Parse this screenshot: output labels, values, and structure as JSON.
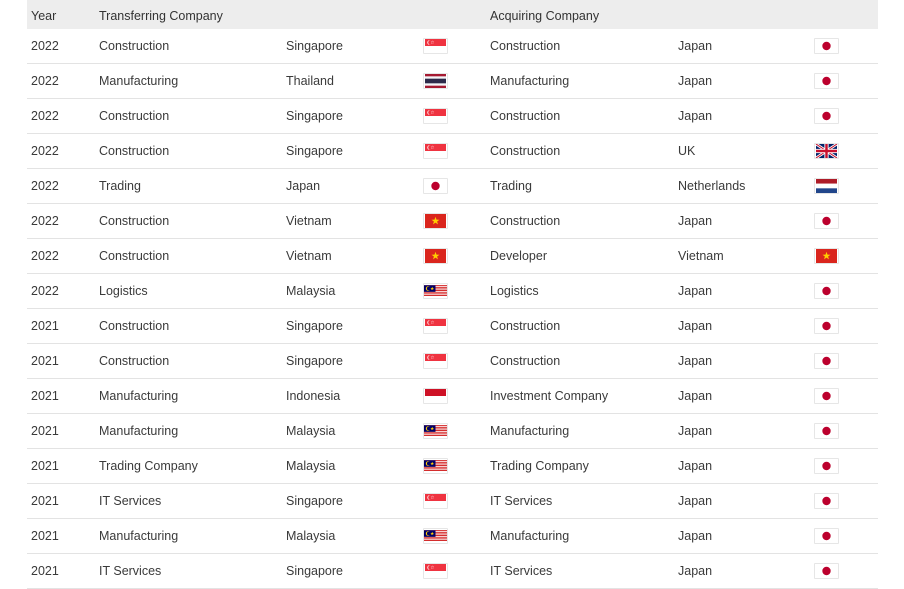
{
  "header": {
    "year": "Year",
    "transferring_company": "Transferring Company",
    "acquiring_company": "Acquiring Company"
  },
  "rows": [
    {
      "year": "2022",
      "t_industry": "Construction",
      "t_country": "Singapore",
      "t_flag": "singapore-flag-icon",
      "a_industry": "Construction",
      "a_country": "Japan",
      "a_flag": "japan-flag-icon"
    },
    {
      "year": "2022",
      "t_industry": "Manufacturing",
      "t_country": "Thailand",
      "t_flag": "thailand-flag-icon",
      "a_industry": "Manufacturing",
      "a_country": "Japan",
      "a_flag": "japan-flag-icon"
    },
    {
      "year": "2022",
      "t_industry": "Construction",
      "t_country": "Singapore",
      "t_flag": "singapore-flag-icon",
      "a_industry": "Construction",
      "a_country": "Japan",
      "a_flag": "japan-flag-icon"
    },
    {
      "year": "2022",
      "t_industry": "Construction",
      "t_country": "Singapore",
      "t_flag": "singapore-flag-icon",
      "a_industry": "Construction",
      "a_country": "UK",
      "a_flag": "uk-flag-icon"
    },
    {
      "year": "2022",
      "t_industry": "Trading",
      "t_country": "Japan",
      "t_flag": "japan-flag-icon",
      "a_industry": "Trading",
      "a_country": "Netherlands",
      "a_flag": "netherlands-flag-icon"
    },
    {
      "year": "2022",
      "t_industry": "Construction",
      "t_country": "Vietnam",
      "t_flag": "vietnam-flag-icon",
      "a_industry": "Construction",
      "a_country": "Japan",
      "a_flag": "japan-flag-icon"
    },
    {
      "year": "2022",
      "t_industry": "Construction",
      "t_country": "Vietnam",
      "t_flag": "vietnam-flag-icon",
      "a_industry": "Developer",
      "a_country": "Vietnam",
      "a_flag": "vietnam-flag-icon"
    },
    {
      "year": "2022",
      "t_industry": "Logistics",
      "t_country": "Malaysia",
      "t_flag": "malaysia-flag-icon",
      "a_industry": "Logistics",
      "a_country": "Japan",
      "a_flag": "japan-flag-icon"
    },
    {
      "year": "2021",
      "t_industry": "Construction",
      "t_country": "Singapore",
      "t_flag": "singapore-flag-icon",
      "a_industry": "Construction",
      "a_country": "Japan",
      "a_flag": "japan-flag-icon"
    },
    {
      "year": "2021",
      "t_industry": "Construction",
      "t_country": "Singapore",
      "t_flag": "singapore-flag-icon",
      "a_industry": "Construction",
      "a_country": "Japan",
      "a_flag": "japan-flag-icon"
    },
    {
      "year": "2021",
      "t_industry": "Manufacturing",
      "t_country": "Indonesia",
      "t_flag": "indonesia-flag-icon",
      "a_industry": "Investment Company",
      "a_country": "Japan",
      "a_flag": "japan-flag-icon"
    },
    {
      "year": "2021",
      "t_industry": "Manufacturing",
      "t_country": "Malaysia",
      "t_flag": "malaysia-flag-icon",
      "a_industry": "Manufacturing",
      "a_country": "Japan",
      "a_flag": "japan-flag-icon"
    },
    {
      "year": "2021",
      "t_industry": "Trading Company",
      "t_country": "Malaysia",
      "t_flag": "malaysia-flag-icon",
      "a_industry": "Trading Company",
      "a_country": "Japan",
      "a_flag": "japan-flag-icon"
    },
    {
      "year": "2021",
      "t_industry": "IT Services",
      "t_country": "Singapore",
      "t_flag": "singapore-flag-icon",
      "a_industry": "IT Services",
      "a_country": "Japan",
      "a_flag": "japan-flag-icon"
    },
    {
      "year": "2021",
      "t_industry": "Manufacturing",
      "t_country": "Malaysia",
      "t_flag": "malaysia-flag-icon",
      "a_industry": "Manufacturing",
      "a_country": "Japan",
      "a_flag": "japan-flag-icon"
    },
    {
      "year": "2021",
      "t_industry": "IT Services",
      "t_country": "Singapore",
      "t_flag": "singapore-flag-icon",
      "a_industry": "IT Services",
      "a_country": "Japan",
      "a_flag": "japan-flag-icon"
    }
  ],
  "colors": {
    "header_bg": "#ededed",
    "row_border": "#e3e3e3",
    "text": "#3a3a3a"
  }
}
